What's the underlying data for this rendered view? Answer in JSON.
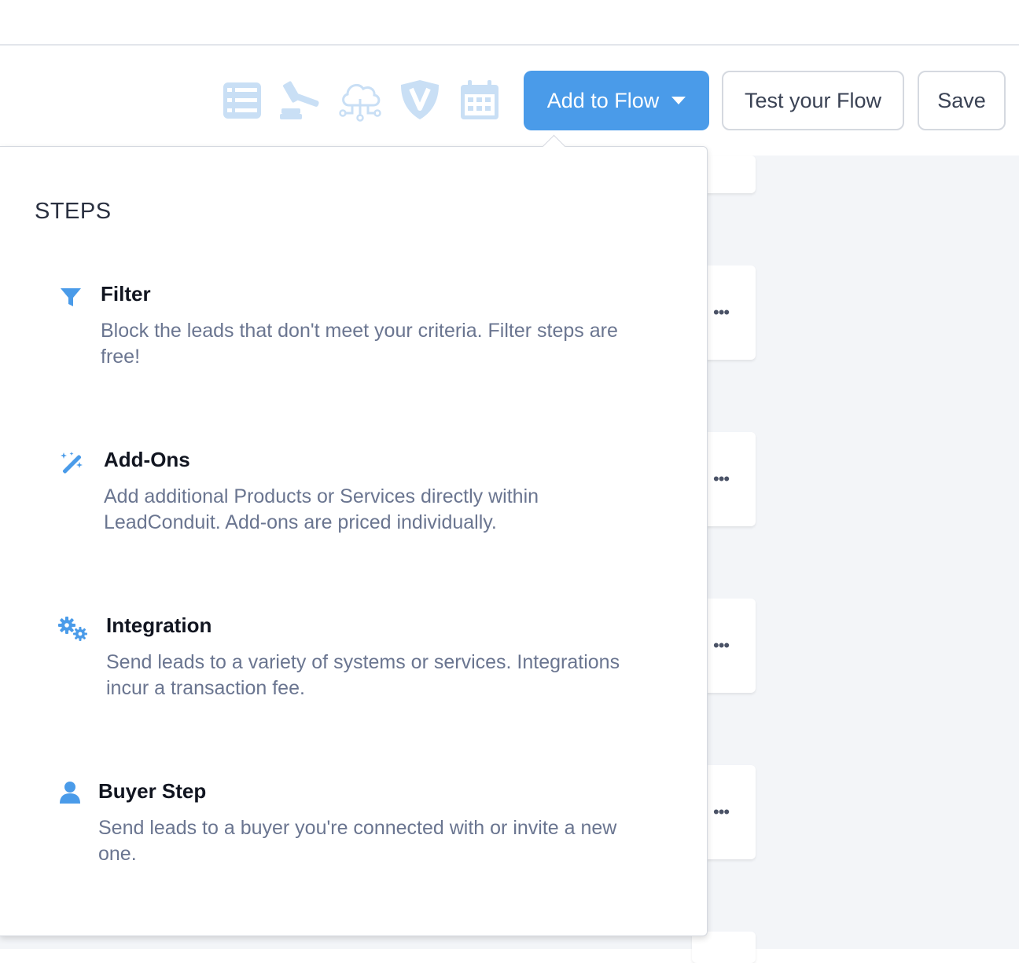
{
  "toolbar": {
    "icons": [
      "list-icon",
      "gavel-icon",
      "cloud-network-icon",
      "shield-v-icon",
      "calendar-icon"
    ],
    "add_to_flow_label": "Add to Flow",
    "test_flow_label": "Test your Flow",
    "save_label": "Save"
  },
  "panel": {
    "title": "STEPS",
    "steps": [
      {
        "icon": "filter-icon",
        "title": "Filter",
        "description": "Block the leads that don't meet your criteria. Filter steps are free!"
      },
      {
        "icon": "magic-wand-icon",
        "title": "Add-Ons",
        "description": "Add additional Products or Services directly within LeadConduit. Add-ons are priced individually."
      },
      {
        "icon": "gears-icon",
        "title": "Integration",
        "description": "Send leads to a variety of systems or services. Integrations incur a transaction fee."
      },
      {
        "icon": "user-icon",
        "title": "Buyer Step",
        "description": "Send leads to a buyer you're connected with or invite a new one."
      }
    ]
  },
  "background_cards": {
    "menu_glyph": "•••"
  },
  "colors": {
    "accent": "#4a9be9",
    "icon_muted": "#c9dff5",
    "description_text": "#6a7590"
  }
}
